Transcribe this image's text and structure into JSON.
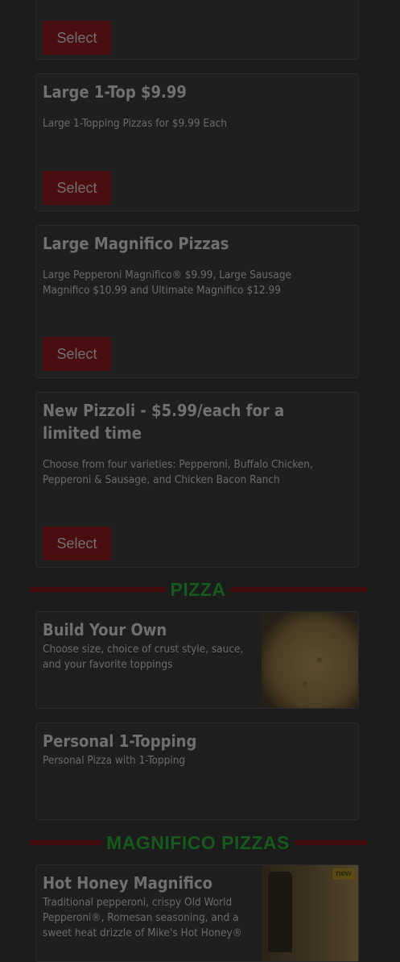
{
  "deals": [
    {
      "title": "",
      "description": "",
      "button": "Select"
    },
    {
      "title": "Large 1-Top $9.99",
      "description": "Large 1-Topping Pizzas for $9.99 Each",
      "button": "Select"
    },
    {
      "title": "Large Magnifico Pizzas",
      "description": "Large Pepperoni Magnifico® $9.99, Large Sausage Magnifico $10.99 and Ultimate Magnifico $12.99",
      "button": "Select"
    },
    {
      "title": "New Pizzoli - $5.99/each for a limited time",
      "description": "Choose from four varieties: Pepperoni, Buffalo Chicken, Pepperoni & Sausage, and Chicken Bacon Ranch",
      "button": "Select"
    }
  ],
  "sections": {
    "pizza": "PIZZA",
    "magnifico": "MAGNIFICO PIZZAS"
  },
  "pizza_items": [
    {
      "title": "Build Your Own",
      "description": "Choose size, choice of crust style, sauce, and your favorite toppings"
    },
    {
      "title": "Personal 1-Topping",
      "description": "Personal Pizza with 1-Topping"
    }
  ],
  "magnifico_items": [
    {
      "title": "Hot Honey Magnifico",
      "description": "Traditional pepperoni, crispy Old World Pepperoni®, Romesan seasoning, and a sweet heat drizzle of Mike's Hot Honey®",
      "badge": "new"
    }
  ],
  "colors": {
    "button_bg": "#4a0d10",
    "section_title": "#165a1e",
    "section_line": "#430a0c"
  }
}
